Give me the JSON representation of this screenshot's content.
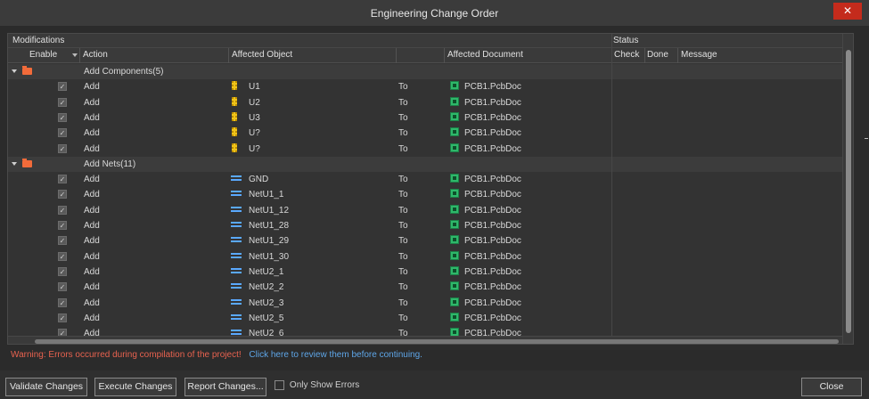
{
  "window": {
    "title": "Engineering Change Order",
    "close_glyph": "✕"
  },
  "headers": {
    "modifications": "Modifications",
    "status": "Status",
    "enable": "Enable",
    "action": "Action",
    "affected_object": "Affected Object",
    "affected_document": "Affected Document",
    "check": "Check",
    "done": "Done",
    "message": "Message"
  },
  "groups": [
    {
      "label": "Add Components(5)",
      "icon": "folder-icon",
      "rows": [
        {
          "action": "Add",
          "object": "U1",
          "to": "To",
          "document": "PCB1.PcbDoc",
          "object_icon": "component-icon"
        },
        {
          "action": "Add",
          "object": "U2",
          "to": "To",
          "document": "PCB1.PcbDoc",
          "object_icon": "component-icon"
        },
        {
          "action": "Add",
          "object": "U3",
          "to": "To",
          "document": "PCB1.PcbDoc",
          "object_icon": "component-icon"
        },
        {
          "action": "Add",
          "object": "U?",
          "to": "To",
          "document": "PCB1.PcbDoc",
          "object_icon": "component-icon"
        },
        {
          "action": "Add",
          "object": "U?",
          "to": "To",
          "document": "PCB1.PcbDoc",
          "object_icon": "component-icon"
        }
      ]
    },
    {
      "label": "Add Nets(11)",
      "icon": "folder-icon",
      "rows": [
        {
          "action": "Add",
          "object": "GND",
          "to": "To",
          "document": "PCB1.PcbDoc",
          "object_icon": "net-icon"
        },
        {
          "action": "Add",
          "object": "NetU1_1",
          "to": "To",
          "document": "PCB1.PcbDoc",
          "object_icon": "net-icon"
        },
        {
          "action": "Add",
          "object": "NetU1_12",
          "to": "To",
          "document": "PCB1.PcbDoc",
          "object_icon": "net-icon"
        },
        {
          "action": "Add",
          "object": "NetU1_28",
          "to": "To",
          "document": "PCB1.PcbDoc",
          "object_icon": "net-icon"
        },
        {
          "action": "Add",
          "object": "NetU1_29",
          "to": "To",
          "document": "PCB1.PcbDoc",
          "object_icon": "net-icon"
        },
        {
          "action": "Add",
          "object": "NetU1_30",
          "to": "To",
          "document": "PCB1.PcbDoc",
          "object_icon": "net-icon"
        },
        {
          "action": "Add",
          "object": "NetU2_1",
          "to": "To",
          "document": "PCB1.PcbDoc",
          "object_icon": "net-icon"
        },
        {
          "action": "Add",
          "object": "NetU2_2",
          "to": "To",
          "document": "PCB1.PcbDoc",
          "object_icon": "net-icon"
        },
        {
          "action": "Add",
          "object": "NetU2_3",
          "to": "To",
          "document": "PCB1.PcbDoc",
          "object_icon": "net-icon"
        },
        {
          "action": "Add",
          "object": "NetU2_5",
          "to": "To",
          "document": "PCB1.PcbDoc",
          "object_icon": "net-icon"
        },
        {
          "action": "Add",
          "object": "NetU2_6",
          "to": "To",
          "document": "PCB1.PcbDoc",
          "object_icon": "net-icon"
        }
      ]
    }
  ],
  "warning": {
    "text": "Warning: Errors occurred during compilation of the project!",
    "link": "Click here to review them before continuing."
  },
  "buttons": {
    "validate": "Validate Changes",
    "execute": "Execute Changes",
    "report": "Report Changes...",
    "only_show_errors": "Only Show Errors",
    "close": "Close"
  },
  "colors": {
    "warning": "#e8624f",
    "link": "#5ea6e8",
    "close_button": "#c42b1c",
    "folder": "#f26b3a"
  }
}
